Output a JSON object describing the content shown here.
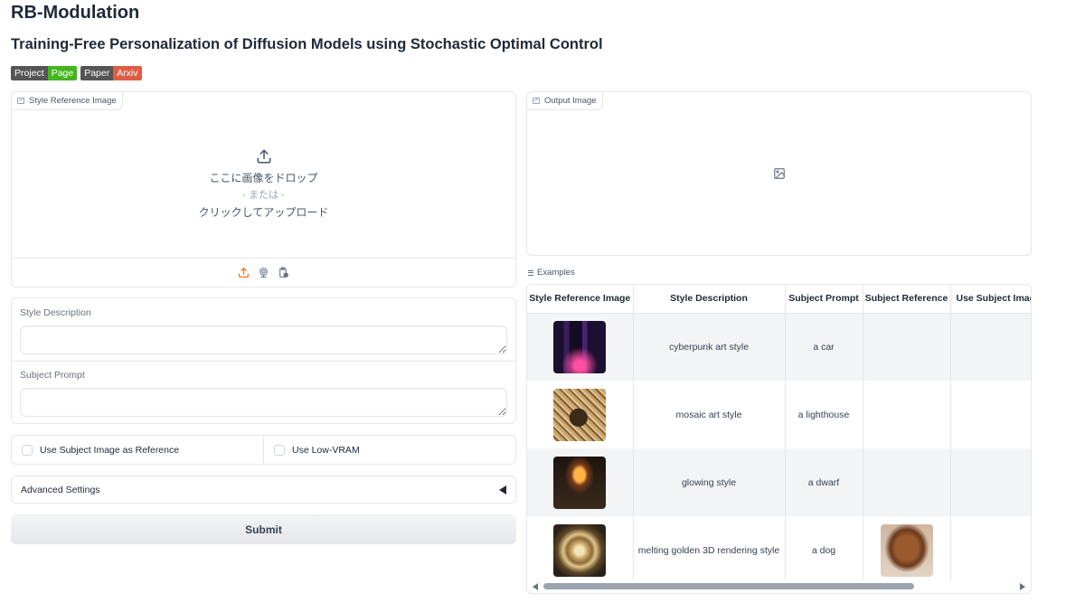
{
  "header": {
    "title": "RB-Modulation",
    "subtitle": "Training-Free Personalization of Diffusion Models using Stochastic Optimal Control"
  },
  "badges": [
    {
      "left": "Project",
      "right": "Page",
      "color": "#44b51f"
    },
    {
      "left": "Paper",
      "right": "Arxiv",
      "color": "#e05d44"
    }
  ],
  "style_reference": {
    "label": "Style Reference Image",
    "drop_text": "ここに画像をドロップ",
    "or_text": "- または -",
    "click_text": "クリックしてアップロード"
  },
  "output": {
    "label": "Output Image"
  },
  "fields": {
    "style_description_label": "Style Description",
    "style_description_value": "",
    "subject_prompt_label": "Subject Prompt",
    "subject_prompt_value": ""
  },
  "checkboxes": {
    "use_subject_image": "Use Subject Image as Reference",
    "use_low_vram": "Use Low-VRAM"
  },
  "advanced": {
    "label": "Advanced Settings"
  },
  "submit": {
    "label": "Submit"
  },
  "examples": {
    "label": "Examples",
    "columns": [
      "Style Reference Image",
      "Style Description",
      "Subject Prompt",
      "Subject Reference",
      "Use Subject Image"
    ],
    "rows": [
      {
        "style_image": "cyberpunk-city-thumbnail",
        "style_description": "cyberpunk art style",
        "subject_prompt": "a car",
        "subject_reference": "",
        "use_subject_image": "false"
      },
      {
        "style_image": "mosaic-teapot-thumbnail",
        "style_description": "mosaic art style",
        "subject_prompt": "a lighthouse",
        "subject_reference": "",
        "use_subject_image": "false"
      },
      {
        "style_image": "glowing-mushroom-thumbnail",
        "style_description": "glowing style",
        "subject_prompt": "a dwarf",
        "subject_reference": "",
        "use_subject_image": "false"
      },
      {
        "style_image": "golden-rose-thumbnail",
        "style_description": "melting golden 3D rendering style",
        "subject_prompt": "a dog",
        "subject_reference": "dog-photo-thumbnail",
        "use_subject_image": "true"
      }
    ]
  }
}
